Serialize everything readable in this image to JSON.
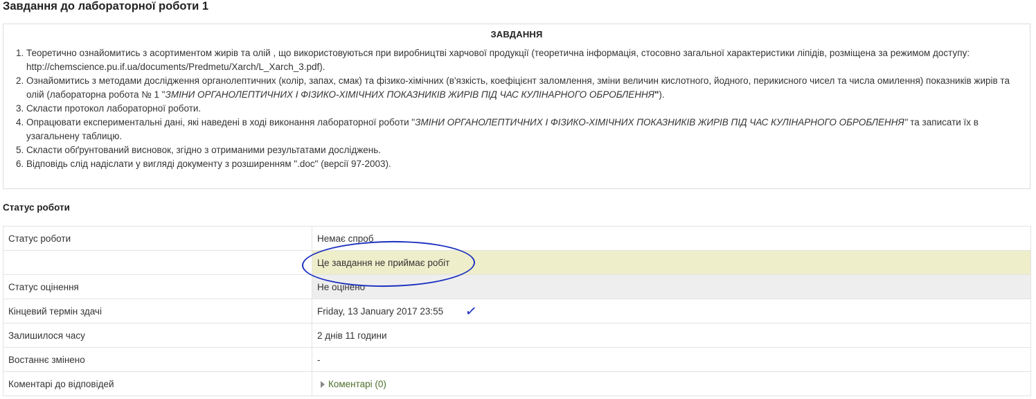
{
  "page": {
    "title": "Завдання до лабораторної роботи 1"
  },
  "intro": {
    "heading": "ЗАВДАННЯ",
    "items": [
      {
        "text_a": "Теоретично ознайомитись з асортиментом жирів та олій , що використовуються при виробництві харчової продукції (теоретична інформація, стосовно загальної характеристики ліпідів, розміщена за режимом доступу: http://chemscience.pu.if.ua/documents/Predmetu/Xarch/L_Xarch_3.pdf)."
      },
      {
        "text_a": "Ознайомитись з методами дослідження органолептичних (колір, запах, смак) та фізико-хімічних (в'язкість, коефіцієнт заломлення, зміни величин кислотного, йодного, перикисного чисел та числа омилення) показників жирів та олій (лабораторна робота № 1 \"",
        "text_em": "ЗМІНИ ОРГАНОЛЕПТИЧНИХ І ФІЗИКО-ХІМІЧНИХ ПОКАЗНИКІВ ЖИРІВ ПІД ЧАС КУЛІНАРНОГО ОБРОБЛЕННЯ",
        "text_b": "\"",
        "text_c": ")."
      },
      {
        "text_a": "Скласти протокол лабораторної роботи."
      },
      {
        "text_a": "Опрацювати експериментальні дані, які наведені в ході виконання лабораторної роботи \"",
        "text_em": "ЗМІНИ ОРГАНОЛЕПТИЧНИХ І ФІЗИКО-ХІМІЧНИХ ПОКАЗНИКІВ ЖИРІВ ПІД ЧАС КУЛІНАРНОГО ОБРОБЛЕННЯ\"",
        "text_c": " та записати їх в узагальнену таблицю."
      },
      {
        "text_a": "Скласти обґрунтований висновок, згідно з отриманими результатами досліджень."
      },
      {
        "text_a": "Відповідь слід надіслати у вигляді документу з розширенням \".doc\" (версії 97-2003)."
      }
    ]
  },
  "status": {
    "section_title": "Статус роботи",
    "rows": {
      "submission": {
        "label": "Статус роботи",
        "value": "Немає спроб"
      },
      "warning": {
        "label": "",
        "value": "Це завдання не приймає робіт"
      },
      "grading": {
        "label": "Статус оцінення",
        "value": "Не оцінено"
      },
      "due": {
        "label": "Кінцевий термін здачі",
        "value": "Friday, 13 January 2017 23:55"
      },
      "remaining": {
        "label": "Залишилося часу",
        "value": "2 днів 11 години"
      },
      "modified": {
        "label": "Востаннє змінено",
        "value": "-"
      },
      "comments": {
        "label": "Коментарі до відповідей",
        "value": "Коментарі (0)"
      }
    }
  },
  "annotations": {
    "ellipse_color": "#1a2fbf",
    "check_glyph": "✓"
  },
  "colors": {
    "warning_bg": "#efeecb",
    "grading_bg": "#eeeeee",
    "link": "#4c6e2a"
  }
}
